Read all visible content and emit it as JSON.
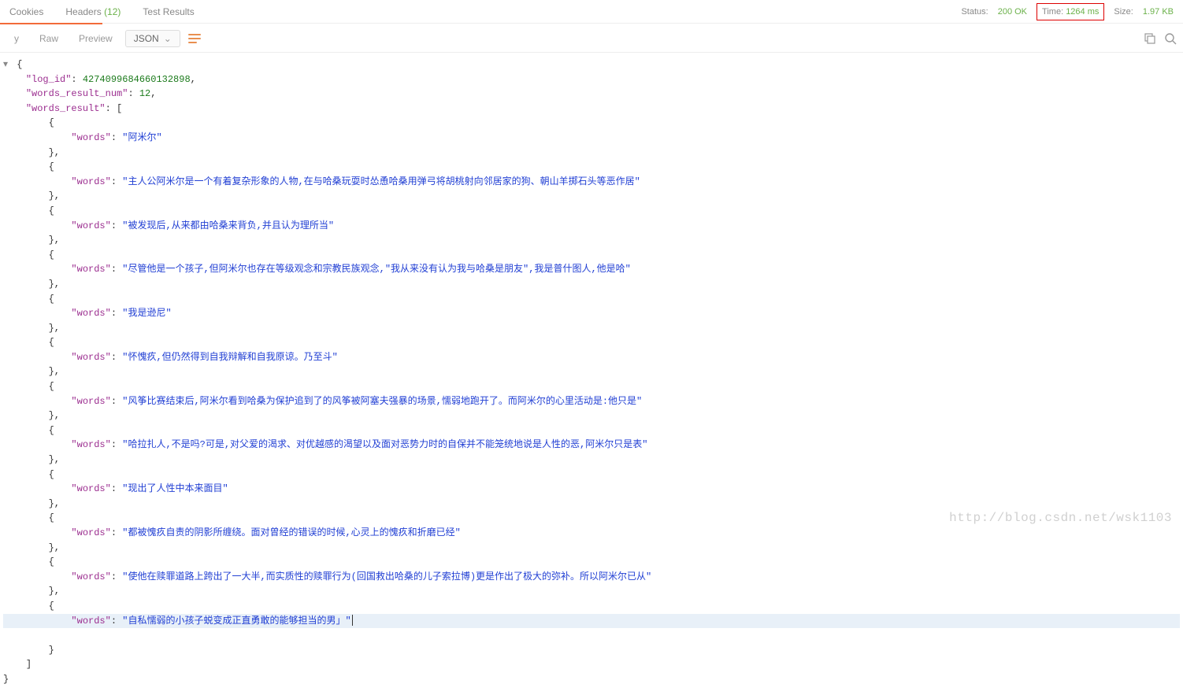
{
  "tabs": {
    "cookies": "Cookies",
    "headers": "Headers",
    "headers_count": "(12)",
    "test_results": "Test Results"
  },
  "status_bar": {
    "status_label": "Status:",
    "status_value": "200 OK",
    "time_label": "Time:",
    "time_value": "1264 ms",
    "size_label": "Size:",
    "size_value": "1.97 KB"
  },
  "toolbar": {
    "y": "y",
    "raw": "Raw",
    "preview": "Preview",
    "json": "JSON"
  },
  "response": {
    "log_id_key": "\"log_id\"",
    "log_id_val": "4274099684660132898",
    "wrn_key": "\"words_result_num\"",
    "wrn_val": "12",
    "wr_key": "\"words_result\"",
    "words_key": "\"words\"",
    "items": [
      "\"阿米尔\"",
      "\"主人公阿米尔是一个有着复杂形象的人物,在与哈桑玩耍时怂恿哈桑用弹弓将胡桃射向邻居家的狗、朝山羊掷石头等恶作居\"",
      "\"被发现后,从来都由哈桑来背负,并且认为理所当\"",
      "\"尽管他是一个孩子,但阿米尔也存在等级观念和宗教民族观念,\"我从来没有认为我与哈桑是朋友\",我是普什图人,他是哈\"",
      "\"我是逊尼\"",
      "\"怀愧疚,但仍然得到自我辩解和自我原谅。乃至斗\"",
      "\"风筝比赛结束后,阿米尔看到哈桑为保护追到了的风筝被阿塞夫强暴的场景,懦弱地跑开了。而阿米尔的心里活动是:他只是\"",
      "\"哈拉扎人,不是吗?可是,对父爱的渴求、对优越感的渴望以及面对恶势力时的自保并不能笼统地说是人性的恶,阿米尔只是表\"",
      "\"现出了人性中本来面目\"",
      "\"都被愧疚自责的阴影所缠绕。面对曾经的错误的时候,心灵上的愧疚和折磨已经\"",
      "\"使他在赎罪道路上跨出了一大半,而实质性的赎罪行为(回国救出哈桑的儿子索拉博)更是作出了极大的弥补。所以阿米尔已从\"",
      "\"自私懦弱的小孩子蜕变成正直勇敢的能够担当的男」\""
    ]
  },
  "watermark": "http://blog.csdn.net/wsk1103"
}
